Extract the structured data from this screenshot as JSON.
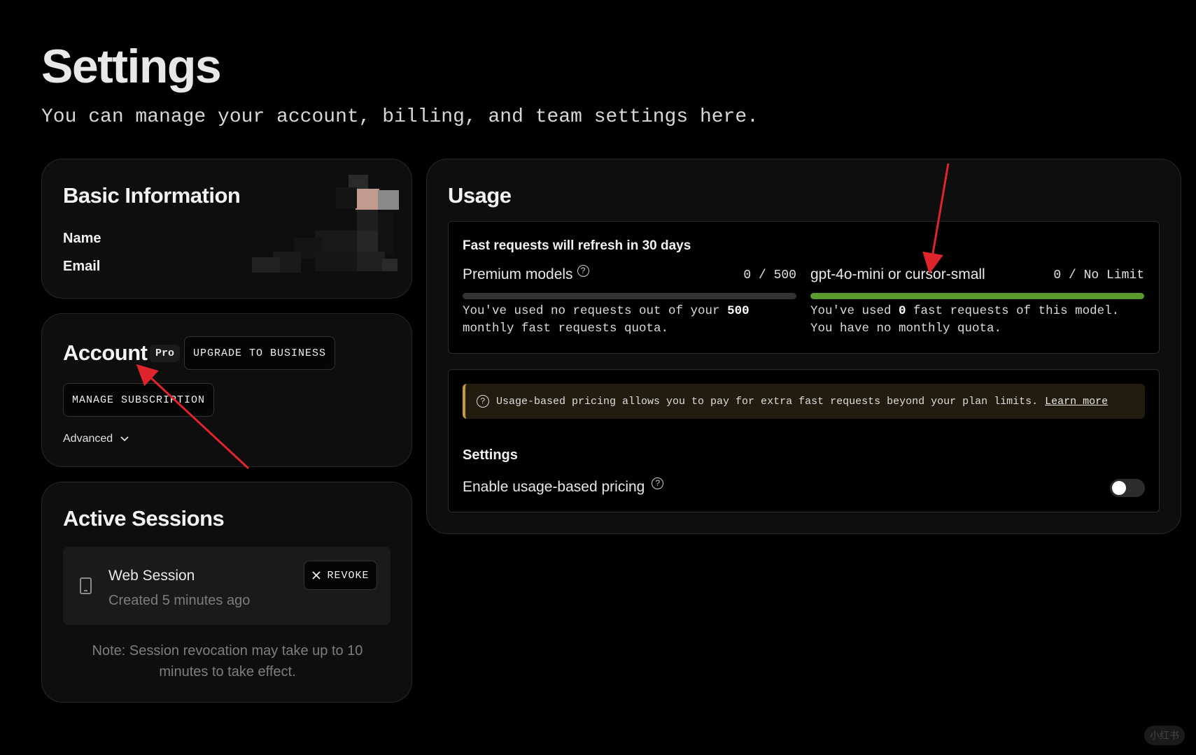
{
  "page": {
    "title": "Settings",
    "subtitle": "You can manage your account, billing, and team settings here."
  },
  "basic_info": {
    "title": "Basic Information",
    "name_label": "Name",
    "email_label": "Email"
  },
  "account": {
    "title": "Account",
    "plan_badge": "Pro",
    "upgrade_label": "UPGRADE TO BUSINESS",
    "manage_label": "MANAGE SUBSCRIPTION",
    "advanced_label": "Advanced"
  },
  "sessions": {
    "title": "Active Sessions",
    "items": [
      {
        "name": "Web Session",
        "created": "Created 5 minutes ago",
        "revoke_label": "REVOKE"
      }
    ],
    "note": "Note: Session revocation may take up to 10 minutes to take effect."
  },
  "usage": {
    "title": "Usage",
    "refresh_text": "Fast requests will refresh in 30 days",
    "models": [
      {
        "name": "Premium models",
        "count": "0 / 500",
        "fill_fraction": 0,
        "desc_prefix": "You've used no requests out of your ",
        "desc_bold": "500",
        "desc_suffix": " monthly fast requests quota."
      },
      {
        "name": "gpt-4o-mini or cursor-small",
        "count": "0 / No Limit",
        "fill_fraction": 1,
        "desc_prefix": "You've used ",
        "desc_bold": "0",
        "desc_suffix": " fast requests of this model. You have no monthly quota."
      }
    ],
    "banner_text": "Usage-based pricing allows you to pay for extra fast requests beyond your plan limits.",
    "banner_link": "Learn more",
    "settings_label": "Settings",
    "toggle_label": "Enable usage-based pricing",
    "toggle_on": false
  },
  "watermark": "小红书",
  "colors": {
    "background": "#000000",
    "card": "#0e0e0e",
    "progress_fill": "#5b9a2c",
    "banner_accent": "#c99a3b",
    "annotation_arrow": "#e0242b"
  }
}
